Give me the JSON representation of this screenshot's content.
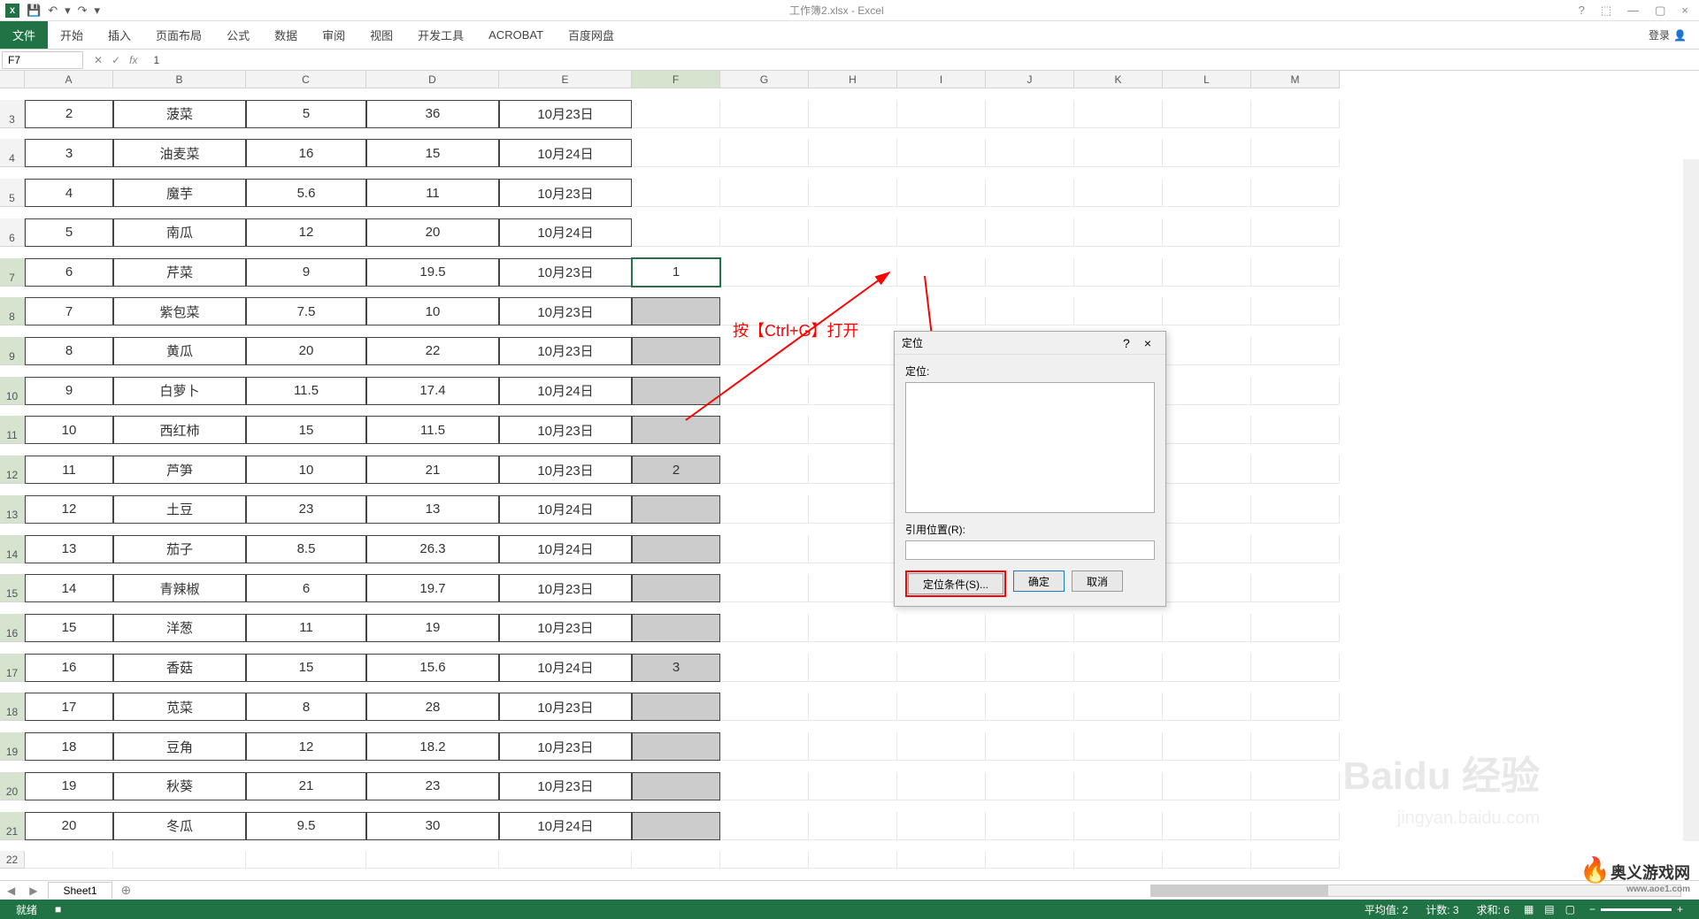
{
  "app": {
    "title": "工作簿2.xlsx - Excel",
    "icon": "X"
  },
  "qat": {
    "save": "💾",
    "undo": "↶",
    "redo": "↷",
    "dropdown": "▾"
  },
  "wincontrols": {
    "help": "?",
    "ribbon_opts": "⬚",
    "min": "—",
    "restore": "▢",
    "close": "×"
  },
  "ribbon": {
    "file": "文件",
    "tabs": [
      "开始",
      "插入",
      "页面布局",
      "公式",
      "数据",
      "审阅",
      "视图",
      "开发工具",
      "ACROBAT",
      "百度网盘"
    ],
    "login": "登录"
  },
  "namebox": "F7",
  "formula": "1",
  "fx": {
    "cancel": "✕",
    "confirm": "✓",
    "fx": "fx"
  },
  "columns": [
    "A",
    "B",
    "C",
    "D",
    "E",
    "F",
    "G",
    "H",
    "I",
    "J",
    "K",
    "L",
    "M"
  ],
  "rows": [
    3,
    4,
    5,
    6,
    7,
    8,
    9,
    10,
    11,
    12,
    13,
    14,
    15,
    16,
    17,
    18,
    19,
    20,
    21,
    22
  ],
  "data_rows": [
    {
      "r": 3,
      "a": "2",
      "b": "菠菜",
      "c": "5",
      "d": "36",
      "e": "10月23日",
      "f": ""
    },
    {
      "r": 4,
      "a": "3",
      "b": "油麦菜",
      "c": "16",
      "d": "15",
      "e": "10月24日",
      "f": ""
    },
    {
      "r": 5,
      "a": "4",
      "b": "魔芋",
      "c": "5.6",
      "d": "11",
      "e": "10月23日",
      "f": ""
    },
    {
      "r": 6,
      "a": "5",
      "b": "南瓜",
      "c": "12",
      "d": "20",
      "e": "10月24日",
      "f": ""
    },
    {
      "r": 7,
      "a": "6",
      "b": "芹菜",
      "c": "9",
      "d": "19.5",
      "e": "10月23日",
      "f": "1"
    },
    {
      "r": 8,
      "a": "7",
      "b": "紫包菜",
      "c": "7.5",
      "d": "10",
      "e": "10月23日",
      "f": ""
    },
    {
      "r": 9,
      "a": "8",
      "b": "黄瓜",
      "c": "20",
      "d": "22",
      "e": "10月23日",
      "f": ""
    },
    {
      "r": 10,
      "a": "9",
      "b": "白萝卜",
      "c": "11.5",
      "d": "17.4",
      "e": "10月24日",
      "f": ""
    },
    {
      "r": 11,
      "a": "10",
      "b": "西红柿",
      "c": "15",
      "d": "11.5",
      "e": "10月23日",
      "f": ""
    },
    {
      "r": 12,
      "a": "11",
      "b": "芦笋",
      "c": "10",
      "d": "21",
      "e": "10月23日",
      "f": "2"
    },
    {
      "r": 13,
      "a": "12",
      "b": "土豆",
      "c": "23",
      "d": "13",
      "e": "10月24日",
      "f": ""
    },
    {
      "r": 14,
      "a": "13",
      "b": "茄子",
      "c": "8.5",
      "d": "26.3",
      "e": "10月24日",
      "f": ""
    },
    {
      "r": 15,
      "a": "14",
      "b": "青辣椒",
      "c": "6",
      "d": "19.7",
      "e": "10月23日",
      "f": ""
    },
    {
      "r": 16,
      "a": "15",
      "b": "洋葱",
      "c": "11",
      "d": "19",
      "e": "10月23日",
      "f": ""
    },
    {
      "r": 17,
      "a": "16",
      "b": "香菇",
      "c": "15",
      "d": "15.6",
      "e": "10月24日",
      "f": "3"
    },
    {
      "r": 18,
      "a": "17",
      "b": "苋菜",
      "c": "8",
      "d": "28",
      "e": "10月23日",
      "f": ""
    },
    {
      "r": 19,
      "a": "18",
      "b": "豆角",
      "c": "12",
      "d": "18.2",
      "e": "10月23日",
      "f": ""
    },
    {
      "r": 20,
      "a": "19",
      "b": "秋葵",
      "c": "21",
      "d": "23",
      "e": "10月23日",
      "f": ""
    },
    {
      "r": 21,
      "a": "20",
      "b": "冬瓜",
      "c": "9.5",
      "d": "30",
      "e": "10月24日",
      "f": ""
    }
  ],
  "annotation": "按【Ctrl+G】打开",
  "dialog": {
    "title": "定位",
    "listlabel": "定位:",
    "reflabel": "引用位置(R):",
    "refvalue": "",
    "special": "定位条件(S)...",
    "ok": "确定",
    "cancel": "取消",
    "help": "?",
    "close": "×"
  },
  "sheets": {
    "name": "Sheet1",
    "add": "⊕",
    "nav_left": "◀",
    "nav_right": "▶"
  },
  "status": {
    "ready": "就绪",
    "rec": "■",
    "avg": "平均值: 2",
    "count": "计数: 3",
    "sum": "求和: 6",
    "zoom_minus": "−",
    "zoom_plus": "+"
  },
  "watermarks": {
    "w1": "Baidu 经验",
    "w2": "jingyan.baidu.com",
    "logo": "奥义游戏网",
    "logo_sub": "www.aoe1.com"
  }
}
